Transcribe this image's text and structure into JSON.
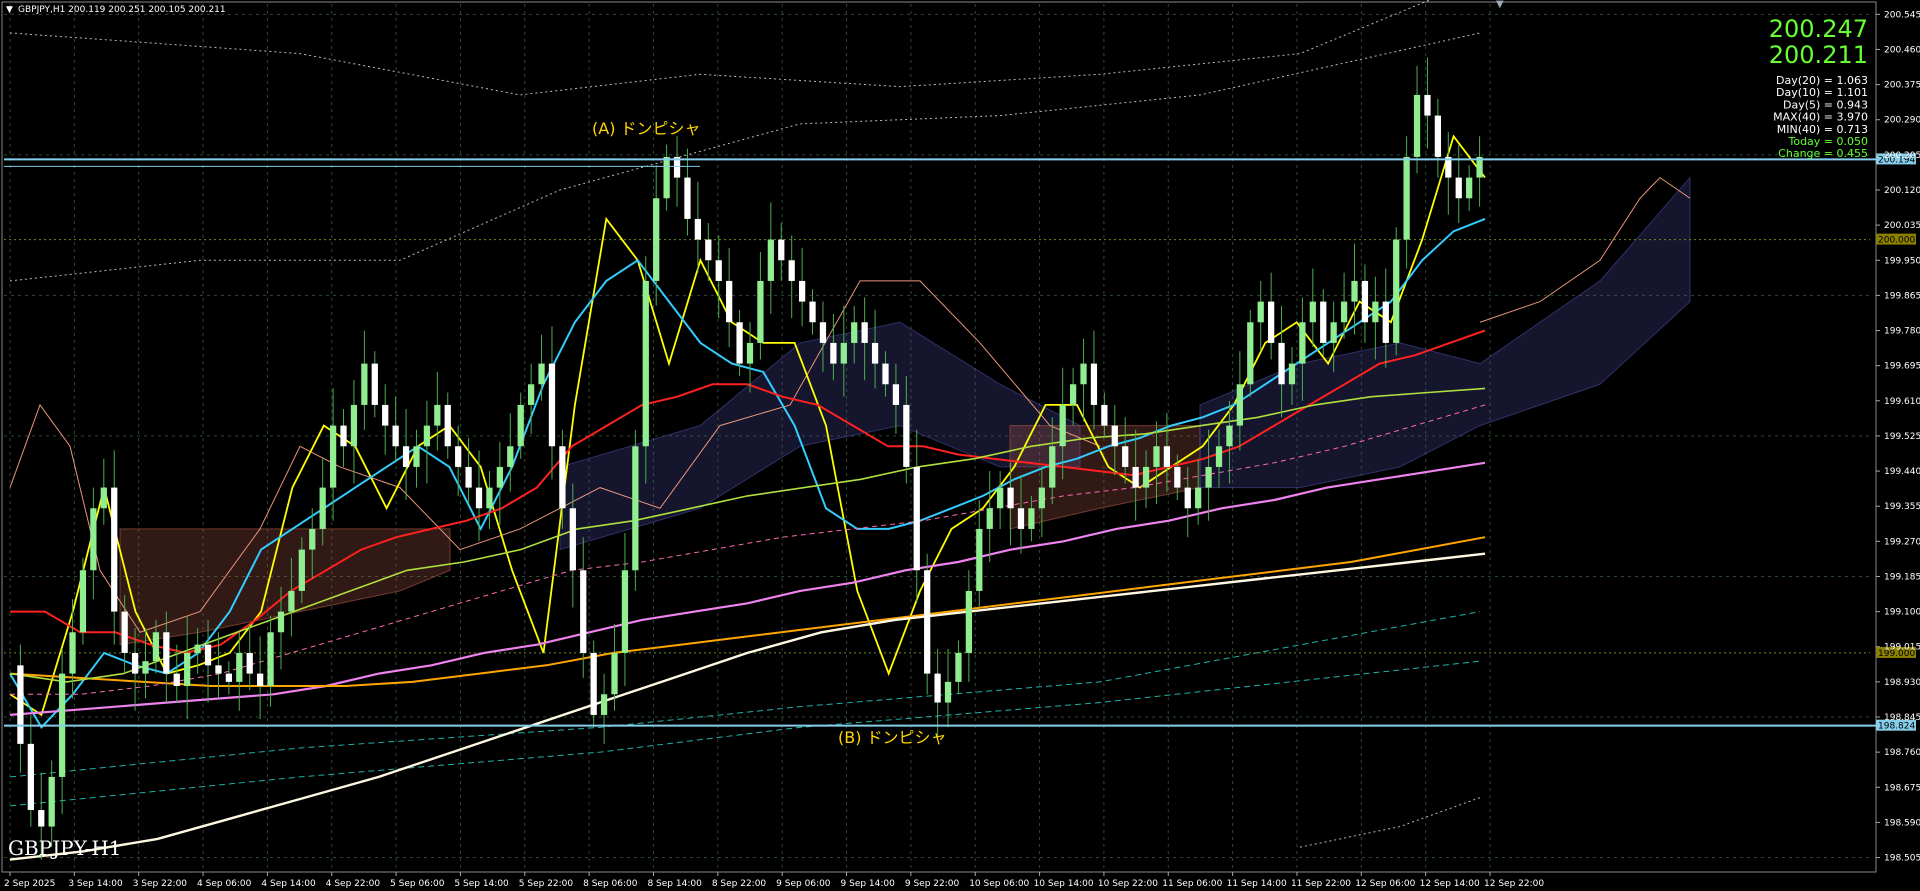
{
  "header": {
    "symbol_line": "GBPJPY,H1  200.119 200.251 200.105 200.211"
  },
  "watermark": "GBPJPY-H1",
  "info_panel": {
    "bid": "200.247",
    "ask": "200.211",
    "lines": [
      "Day(20) = 1.063",
      "Day(10) = 1.101",
      "Day(5) = 0.943",
      "MAX(40) = 3.970",
      "MIN(40) = 0.713",
      "Today = 0.050",
      "Change = 0.455"
    ]
  },
  "annotations": {
    "A": "(A) ドンピシャ",
    "B": "(B) ドンピシャ"
  },
  "price_tags": {
    "line_a": "200.194",
    "line_b": "198.824",
    "level_200": "200.000",
    "level_199": "199.000"
  },
  "colors": {
    "bull_candle": "#90ee90",
    "bear_candle": "#ffffff",
    "ma_yellow": "#ffff00",
    "ma_cyan": "#33ccff",
    "ma_red": "#ff2020",
    "ma_lightgreen": "#b0e040",
    "ma_pink": "#ee82ee",
    "ma_orange": "#ffa500",
    "ma_white": "#fff8e0",
    "horizontal": "#87ceeb",
    "text_green": "#66ff33",
    "annotation": "#ffd700"
  },
  "chart_data": {
    "type": "candlestick",
    "title": "",
    "symbol": "GBPJPY",
    "timeframe": "H1",
    "ylim": [
      198.47,
      200.57
    ],
    "y_ticks": [
      "200.545",
      "200.460",
      "200.375",
      "200.290",
      "200.205",
      "200.120",
      "200.035",
      "199.950",
      "199.865",
      "199.780",
      "199.695",
      "199.610",
      "199.525",
      "199.440",
      "199.355",
      "199.270",
      "199.185",
      "199.100",
      "199.015",
      "198.930",
      "198.845",
      "198.760",
      "198.675",
      "198.590",
      "198.505"
    ],
    "x_ticks": [
      "2 Sep 2025",
      "3 Sep 14:00",
      "3 Sep 22:00",
      "4 Sep 06:00",
      "4 Sep 14:00",
      "4 Sep 22:00",
      "5 Sep 06:00",
      "5 Sep 14:00",
      "5 Sep 22:00",
      "8 Sep 06:00",
      "8 Sep 14:00",
      "8 Sep 22:00",
      "9 Sep 06:00",
      "9 Sep 14:00",
      "9 Sep 22:00",
      "10 Sep 06:00",
      "10 Sep 14:00",
      "10 Sep 22:00",
      "11 Sep 06:00",
      "11 Sep 14:00",
      "11 Sep 22:00",
      "12 Sep 06:00",
      "12 Sep 14:00",
      "12 Sep 22:00"
    ],
    "horizontal_lines": [
      200.194,
      198.824
    ],
    "levels": [
      200.0,
      199.0
    ],
    "close_path": [
      198.97,
      198.78,
      198.62,
      198.58,
      198.7,
      198.95,
      199.05,
      199.2,
      199.35,
      199.4,
      199.1,
      199.0,
      198.95,
      198.98,
      199.05,
      198.95,
      198.92,
      199.0,
      199.02,
      198.97,
      198.95,
      198.93,
      199.0,
      198.95,
      198.92,
      199.05,
      199.1,
      199.15,
      199.25,
      199.3,
      199.4,
      199.55,
      199.5,
      199.6,
      199.7,
      199.6,
      199.55,
      199.5,
      199.45,
      199.5,
      199.55,
      199.6,
      199.5,
      199.45,
      199.4,
      199.35,
      199.4,
      199.45,
      199.5,
      199.6,
      199.65,
      199.7,
      199.5,
      199.35,
      199.2,
      199.0,
      198.85,
      198.9,
      199.0,
      199.2,
      199.5,
      199.9,
      200.1,
      200.2,
      200.15,
      200.05,
      200.0,
      199.95,
      199.9,
      199.8,
      199.7,
      199.75,
      199.9,
      200.0,
      199.95,
      199.9,
      199.85,
      199.8,
      199.75,
      199.7,
      199.75,
      199.8,
      199.75,
      199.7,
      199.65,
      199.6,
      199.45,
      199.2,
      198.95,
      198.88,
      198.93,
      199.0,
      199.15,
      199.3,
      199.35,
      199.4,
      199.35,
      199.3,
      199.35,
      199.4,
      199.5,
      199.6,
      199.65,
      199.7,
      199.6,
      199.55,
      199.5,
      199.45,
      199.4,
      199.45,
      199.5,
      199.45,
      199.4,
      199.35,
      199.4,
      199.45,
      199.5,
      199.55,
      199.65,
      199.8,
      199.85,
      199.75,
      199.65,
      199.7,
      199.8,
      199.85,
      199.75,
      199.8,
      199.85,
      199.9,
      199.8,
      199.85,
      199.75,
      200.0,
      200.2,
      200.35,
      200.3,
      200.2,
      200.15,
      200.1,
      200.15,
      200.2
    ],
    "series": [
      {
        "name": "MA yellow",
        "values": [
          198.9,
          198.85,
          199.1,
          199.4,
          199.1,
          198.95,
          198.97,
          199.0,
          199.1,
          199.4,
          199.55,
          199.5,
          199.35,
          199.5,
          199.55,
          199.45,
          199.2,
          199.0,
          199.6,
          200.05,
          199.95,
          199.7,
          199.95,
          199.8,
          199.75,
          199.75,
          199.55,
          199.15,
          198.95,
          199.15,
          199.3,
          199.35,
          199.45,
          199.6,
          199.6,
          199.45,
          199.4,
          199.45,
          199.5,
          199.6,
          199.75,
          199.8,
          199.7,
          199.85,
          199.8,
          200.0,
          200.25,
          200.15
        ]
      },
      {
        "name": "MA cyan",
        "values": [
          198.95,
          198.82,
          198.9,
          199.0,
          198.97,
          198.95,
          199.0,
          199.1,
          199.25,
          199.3,
          199.35,
          199.4,
          199.45,
          199.5,
          199.45,
          199.3,
          199.45,
          199.65,
          199.8,
          199.9,
          199.95,
          199.85,
          199.75,
          199.7,
          199.68,
          199.55,
          199.35,
          199.3,
          199.3,
          199.32,
          199.35,
          199.38,
          199.42,
          199.45,
          199.47,
          199.5,
          199.52,
          199.55,
          199.57,
          199.6,
          199.65,
          199.7,
          199.75,
          199.8,
          199.85,
          199.95,
          200.02,
          200.05
        ]
      },
      {
        "name": "MA red",
        "values": [
          199.1,
          199.1,
          199.05,
          199.05,
          199.02,
          199.0,
          199.02,
          199.08,
          199.15,
          199.2,
          199.25,
          199.28,
          199.3,
          199.32,
          199.35,
          199.4,
          199.5,
          199.55,
          199.6,
          199.62,
          199.65,
          199.65,
          199.62,
          199.6,
          199.55,
          199.5,
          199.5,
          199.48,
          199.47,
          199.46,
          199.45,
          199.44,
          199.43,
          199.45,
          199.47,
          199.5,
          199.55,
          199.6,
          199.65,
          199.7,
          199.72,
          199.75,
          199.78
        ]
      },
      {
        "name": "MA pink",
        "values": [
          198.85,
          198.86,
          198.87,
          198.88,
          198.89,
          198.9,
          198.92,
          198.95,
          198.97,
          199.0,
          199.02,
          199.05,
          199.08,
          199.1,
          199.12,
          199.15,
          199.17,
          199.2,
          199.22,
          199.25,
          199.27,
          199.3,
          199.32,
          199.35,
          199.37,
          199.4,
          199.42,
          199.44,
          199.46
        ]
      },
      {
        "name": "MA orange",
        "values": [
          198.95,
          198.94,
          198.93,
          198.92,
          198.92,
          198.92,
          198.93,
          198.95,
          198.97,
          199.0,
          199.02,
          199.04,
          199.06,
          199.08,
          199.1,
          199.12,
          199.14,
          199.16,
          199.18,
          199.2,
          199.22,
          199.25,
          199.28
        ]
      },
      {
        "name": "MA white",
        "values": [
          198.5,
          198.52,
          198.55,
          198.6,
          198.65,
          198.7,
          198.76,
          198.82,
          198.88,
          198.94,
          199.0,
          199.05,
          199.08,
          199.1,
          199.12,
          199.14,
          199.16,
          199.18,
          199.2,
          199.22,
          199.24
        ]
      }
    ]
  }
}
